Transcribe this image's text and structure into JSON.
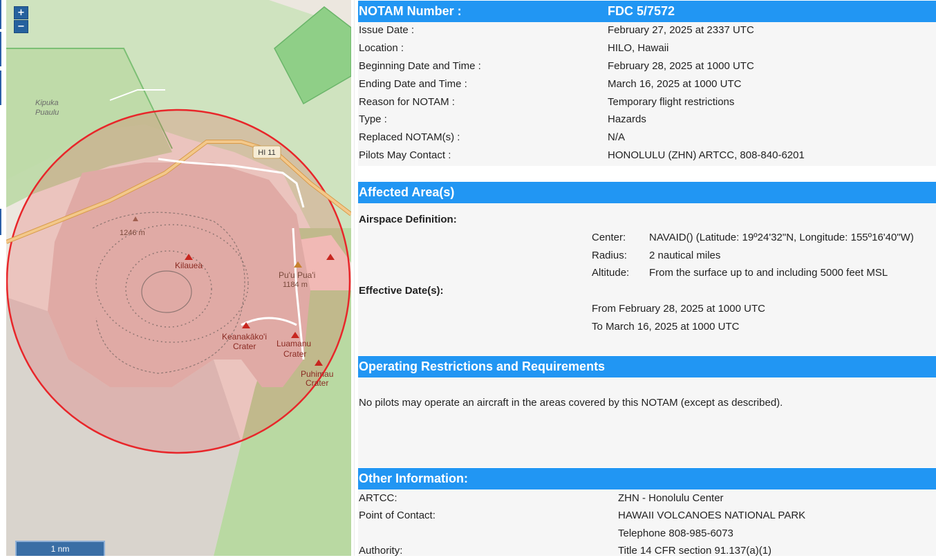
{
  "map": {
    "zoom_in": "+",
    "zoom_out": "−",
    "scale": "1 nm",
    "labels": {
      "kipuka": "Kipuka",
      "puaulu": "Puaulu",
      "road": "HI 11",
      "elev_1246": "1246 m",
      "kilauea": "Kilauea",
      "puupuai": "Pu'u Pua'i",
      "elev_1184": "1184 m",
      "keanakakoi": "Keanakāko'i",
      "keanakakoi_crater": "Crater",
      "luamanu": "Luamanu",
      "luamanu_crater": "Crater",
      "puhimau": "Puhimau",
      "puhimau_crater": "Crater"
    },
    "colors": {
      "restriction_circle": "#e8262a",
      "forest": "#add19e",
      "lava": "#f1ccc4",
      "road": "#f3b76a"
    }
  },
  "notam": {
    "number_label": "NOTAM Number :",
    "number": "FDC 5/7572",
    "fields": [
      {
        "label": "Issue Date :",
        "value": "February 27, 2025 at 2337 UTC"
      },
      {
        "label": "Location :",
        "value": "HILO, Hawaii"
      },
      {
        "label": "Beginning Date and Time :",
        "value": "February 28, 2025 at 1000 UTC"
      },
      {
        "label": "Ending Date and Time :",
        "value": "March 16, 2025 at 1000 UTC"
      },
      {
        "label": "Reason for NOTAM :",
        "value": "Temporary flight restrictions"
      },
      {
        "label": "Type :",
        "value": "Hazards"
      },
      {
        "label": "Replaced NOTAM(s) :",
        "value": "N/A"
      },
      {
        "label": "Pilots May Contact :",
        "value": "HONOLULU (ZHN) ARTCC, 808-840-6201"
      }
    ]
  },
  "affected": {
    "title": "Affected Area(s)",
    "airspace_label": "Airspace Definition:",
    "center_label": "Center:",
    "center_value": "NAVAID() (Latitude: 19º24'32\"N, Longitude: 155º16'40\"W)",
    "radius_label": "Radius:",
    "radius_value": "2 nautical miles",
    "altitude_label": "Altitude:",
    "altitude_value": "From the surface up to and including 5000 feet MSL",
    "effective_label": "Effective Date(s):",
    "from": "From February 28, 2025 at 1000 UTC",
    "to": "To March 16, 2025 at 1000 UTC"
  },
  "operating": {
    "title": "Operating Restrictions and Requirements",
    "text": "No pilots may operate an aircraft in the areas covered by this NOTAM (except as described)."
  },
  "other": {
    "title": "Other Information:",
    "artcc_label": "ARTCC:",
    "artcc_value": "ZHN - Honolulu Center",
    "poc_label": "Point of Contact:",
    "poc_value": "HAWAII VOLCANOES NATIONAL PARK",
    "poc_phone": "Telephone 808-985-6073",
    "authority_label": "Authority:",
    "authority_value": "Title 14 CFR section 91.137(a)(1)"
  }
}
